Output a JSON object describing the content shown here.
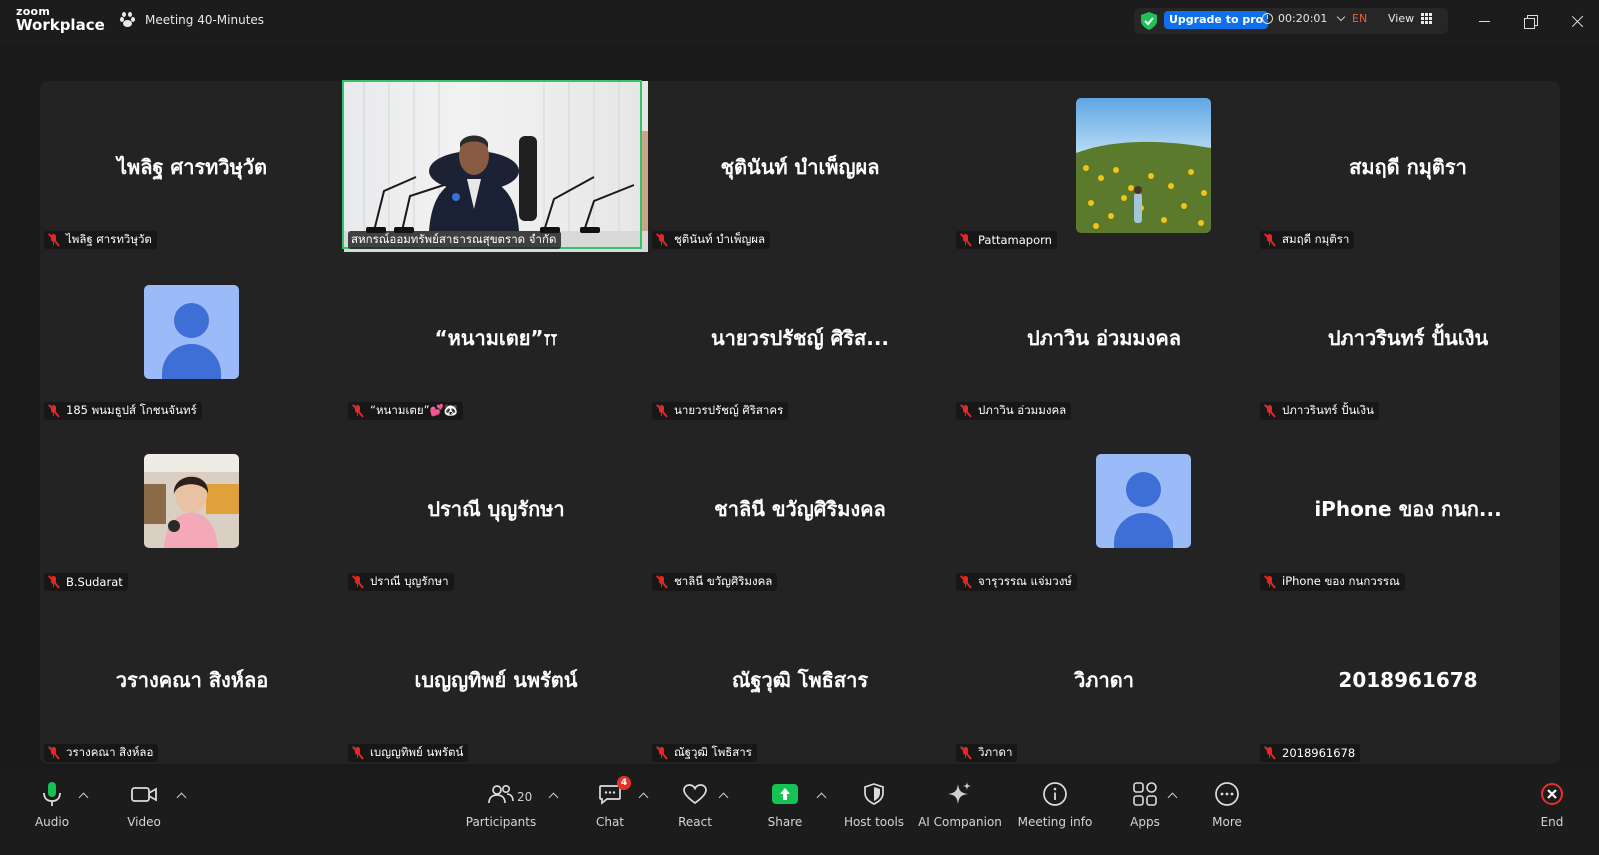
{
  "app": {
    "logo_top": "zoom",
    "logo_bottom": "Workplace",
    "meeting_title": "Meeting 40-Minutes"
  },
  "topbar": {
    "upgrade_label": "Upgrade to pro",
    "timer": "00:20:01",
    "language": "EN",
    "view_label": "View"
  },
  "gallery": {
    "tiles": [
      {
        "big_name": "ไพลิฐ ศารทวิษุวัต",
        "label": "ไพลิฐ ศารทวิษุวัต"
      },
      {
        "big_name": "",
        "label": "สหกรณ์ออมทรัพย์สาธารณสุขตราด จำกัด"
      },
      {
        "big_name": "ชุตินันท์ บำเพ็ญผล",
        "label": "ชุตินันท์ บำเพ็ญผล"
      },
      {
        "big_name": "",
        "label": "Pattamaporn"
      },
      {
        "big_name": "สมฤดี กมุติรา",
        "label": "สมฤดี กมุติรา"
      },
      {
        "big_name": "",
        "label": "185 พนมธูปส์ โกชนจันทร์"
      },
      {
        "big_name": "“หนามเตย”𐏑𐏑",
        "label": "“หนามเตย”💕🐼"
      },
      {
        "big_name": "นายวรปรัชญ์ ศิริส...",
        "label": "นายวรปรัชญ์ ศิริสาคร"
      },
      {
        "big_name": "ปภาวิน อ่วมมงคล",
        "label": "ปภาวิน อ่วมมงคล"
      },
      {
        "big_name": "ปภาวรินทร์ ปั้นเงิน",
        "label": "ปภาวรินทร์ ปั้นเงิน"
      },
      {
        "big_name": "",
        "label": "B.Sudarat"
      },
      {
        "big_name": "ปราณี บุญรักษา",
        "label": "ปราณี บุญรักษา"
      },
      {
        "big_name": "ชาลินี ขวัญศิริมงคล",
        "label": "ชาลินี ขวัญศิริมงคล"
      },
      {
        "big_name": "",
        "label": "จารุวรรณ แจ่มวงษ์"
      },
      {
        "big_name": "iPhone ของ กนก...",
        "label": "iPhone ของ กนกวรรณ"
      },
      {
        "big_name": "วรางคณา สิงห์ลอ",
        "label": "วรางคณา สิงห์ลอ"
      },
      {
        "big_name": "เบญญทิพย์ นพรัตน์",
        "label": "เบญญทิพย์ นพรัตน์"
      },
      {
        "big_name": "ณัฐวุฒิ โพธิสาร",
        "label": "ณัฐวุฒิ โพธิสาร"
      },
      {
        "big_name": "วิภาดา",
        "label": "วิภาดา"
      },
      {
        "big_name": "2018961678",
        "label": "2018961678"
      }
    ]
  },
  "toolbar": {
    "audio": "Audio",
    "video": "Video",
    "participants": "Participants",
    "participants_count": "20",
    "chat": "Chat",
    "chat_badge": "4",
    "react": "React",
    "share": "Share",
    "host_tools": "Host tools",
    "ai_companion": "AI Companion",
    "meeting_info": "Meeting info",
    "apps": "Apps",
    "more": "More",
    "end": "End"
  },
  "colors": {
    "accent_blue": "#0e71eb",
    "share_green": "#17c255",
    "end_red": "#e3322b",
    "active_speaker_border": "#33c46a",
    "avatar_bg": "#9bbaf8",
    "avatar_fg": "#3d6fd6"
  }
}
